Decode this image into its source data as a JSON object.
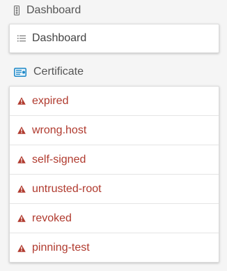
{
  "colors": {
    "alert": "#b03a2e",
    "header_text": "#555555",
    "card_bg": "#ffffff",
    "page_bg": "#f5f5f5",
    "certificate_icon": "#1e88c7"
  },
  "dashboard_section": {
    "title": "Dashboard",
    "icon": "traffic-light-icon",
    "items": [
      {
        "label": "Dashboard",
        "icon": "list-icon"
      }
    ]
  },
  "certificate_section": {
    "title": "Certificate",
    "icon": "certificate-icon",
    "items": [
      {
        "label": "expired",
        "icon": "warning-icon"
      },
      {
        "label": "wrong.host",
        "icon": "warning-icon"
      },
      {
        "label": "self-signed",
        "icon": "warning-icon"
      },
      {
        "label": "untrusted-root",
        "icon": "warning-icon"
      },
      {
        "label": "revoked",
        "icon": "warning-icon"
      },
      {
        "label": "pinning-test",
        "icon": "warning-icon"
      }
    ]
  }
}
